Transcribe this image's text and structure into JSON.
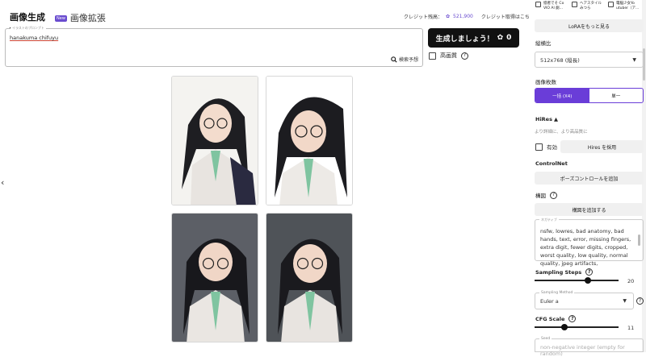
{
  "tabs": [
    {
      "label": "画像生成"
    },
    {
      "label": "画像拡張"
    }
  ],
  "new_badge": "New",
  "credits": {
    "label": "クレジット残高：",
    "value": "521,900",
    "link": "クレジット取得はこちら"
  },
  "prompt": {
    "legend": "イラストのプロンプト",
    "value": "hanakuma chifuyu",
    "search_label": "検索予想"
  },
  "generate_button": {
    "label": "生成しましょう！",
    "cost": "0"
  },
  "hq": {
    "label": "高画質"
  },
  "lora_options": [
    "惚者でそ Co VIO Al 劇...",
    "ヘアスタイル みつら",
    "電脳少女Yo utuber（ア..."
  ],
  "sidebar": {
    "lora_more": "LoRAをもっと見る",
    "aspect": {
      "label": "縦横比",
      "value": "512x768 (縦長)"
    },
    "count": {
      "label": "画像枚数",
      "options": [
        "一括 (X4)",
        "単一"
      ],
      "selected": 0
    },
    "hires": {
      "label": "HiRes",
      "hint": "より詳細に、より高品質に",
      "toggle_label": "有効",
      "button": "Hires を採用"
    },
    "controlnet": {
      "label": "ControlNet",
      "button": "ポーズコントロールを追加"
    },
    "composition": {
      "label": "構図",
      "button": "構図を追加する"
    },
    "negative": {
      "legend": "ネガティブ",
      "value": "nsfw, lowres, bad anatomy, bad hands, text, error, missing fingers, extra digit, fewer digits, cropped, worst quality, low quality, normal quality, jpeg artifacts,"
    },
    "sampling_steps": {
      "label": "Sampling Steps",
      "value": "20",
      "level": 0.63
    },
    "sampling_method": {
      "legend": "Sampling Method",
      "value": "Euler a"
    },
    "cfg": {
      "label": "CFG Scale",
      "value": "11",
      "level": 0.36
    },
    "seed": {
      "legend": "Seed",
      "placeholder": "non-negative integer (empty for random)"
    }
  },
  "colors": {
    "accent": "#6a3dd8",
    "primary_button": "#111111"
  }
}
